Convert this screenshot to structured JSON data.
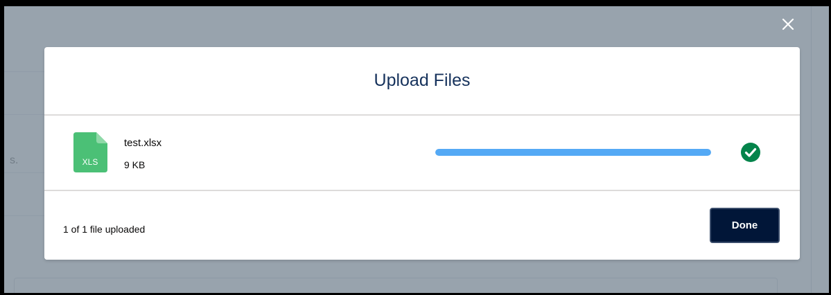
{
  "background": {
    "partial_text": "s."
  },
  "modal": {
    "title": "Upload Files",
    "close_icon": "close-icon",
    "file": {
      "icon": "xls-file-icon",
      "icon_label": "XLS",
      "icon_color": "#4bc076",
      "name": "test.xlsx",
      "size": "9 KB",
      "progress": 1.0,
      "progress_color": "#54a9f5",
      "status_icon": "success-check-icon",
      "status_color": "#04844b"
    },
    "footer": {
      "status_text": "1 of 1 file uploaded",
      "done_label": "Done"
    }
  },
  "colors": {
    "overlay": "#7e8c99",
    "title": "#16325c",
    "done_button": "#011638"
  }
}
